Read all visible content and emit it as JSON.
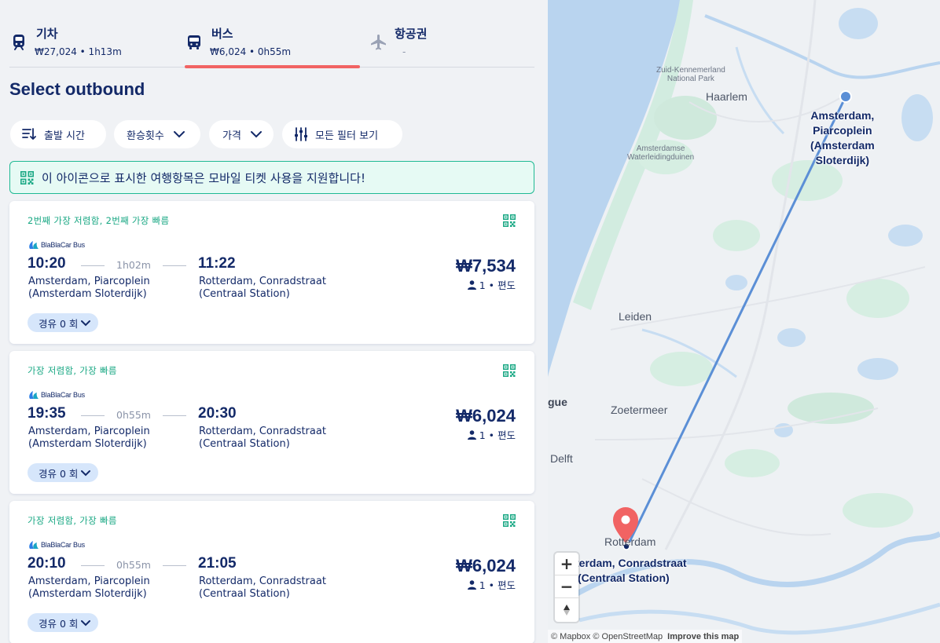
{
  "tabs": [
    {
      "label": "기차",
      "sub": "₩27,024 • 1h13m"
    },
    {
      "label": "버스",
      "sub": "₩6,024 • 0h55m"
    },
    {
      "label": "항공권",
      "sub": "-"
    }
  ],
  "heading": "Select outbound",
  "filters": {
    "departure_time": "출발 시간",
    "transfers": "환승횟수",
    "price": "가격",
    "all_filters": "모든 필터 보기"
  },
  "notice": "이 아이콘으로 표시한 여행항목은 모바일 티켓 사용을 지원합니다!",
  "results": [
    {
      "tag": "2번째 가장 저렴함, 2번째 가장 빠름",
      "brand": "BlaBlaCar Bus",
      "dep_time": "10:20",
      "duration": "1h02m",
      "arr_time": "11:22",
      "dep_station_1": "Amsterdam, Piarcoplein",
      "dep_station_2": "(Amsterdam Sloterdijk)",
      "arr_station_1": "Rotterdam, Conradstraat",
      "arr_station_2": "(Centraal Station)",
      "price": "₩7,534",
      "pax": "1 • 편도",
      "stops": "경유 0 회"
    },
    {
      "tag": "가장 저렴함, 가장 빠름",
      "brand": "BlaBlaCar Bus",
      "dep_time": "19:35",
      "duration": "0h55m",
      "arr_time": "20:30",
      "dep_station_1": "Amsterdam, Piarcoplein",
      "dep_station_2": "(Amsterdam Sloterdijk)",
      "arr_station_1": "Rotterdam, Conradstraat",
      "arr_station_2": "(Centraal Station)",
      "price": "₩6,024",
      "pax": "1 • 편도",
      "stops": "경유 0 회"
    },
    {
      "tag": "가장 저렴함, 가장 빠름",
      "brand": "BlaBlaCar Bus",
      "dep_time": "20:10",
      "duration": "0h55m",
      "arr_time": "21:05",
      "dep_station_1": "Amsterdam, Piarcoplein",
      "dep_station_2": "(Amsterdam Sloterdijk)",
      "arr_station_1": "Rotterdam, Conradstraat",
      "arr_station_2": "(Centraal Station)",
      "price": "₩6,024",
      "pax": "1 • 편도",
      "stops": "경유 0 회"
    }
  ],
  "map": {
    "places": {
      "zuid_kennemerland_1": "Zuid-Kennemerland",
      "zuid_kennemerland_2": "National Park",
      "haarlem": "Haarlem",
      "amsterdamse_1": "Amsterdamse",
      "amsterdamse_2": "Waterleidingduinen",
      "leiden": "Leiden",
      "hague": "gue",
      "zoetermeer": "Zoetermeer",
      "delft": "Delft",
      "rotterdam": "Rotterdam"
    },
    "origin_label_1": "Amsterdam,",
    "origin_label_2": "Piarcoplein",
    "origin_label_3": "(Amsterdam",
    "origin_label_4": "Sloterdijk)",
    "dest_label_1": "terdam, Conradstraat",
    "dest_label_2": "(Centraal Station)",
    "zoom_in": "+",
    "zoom_out": "−",
    "attribution": "© Mapbox © OpenStreetMap",
    "improve": "Improve this map",
    "route_color": "#5b8fd6",
    "pin_color": "#f16363"
  },
  "colors": {
    "primary": "#132968",
    "accent": "#f16363",
    "green": "#1aa884",
    "chip": "#d6e6fb"
  }
}
